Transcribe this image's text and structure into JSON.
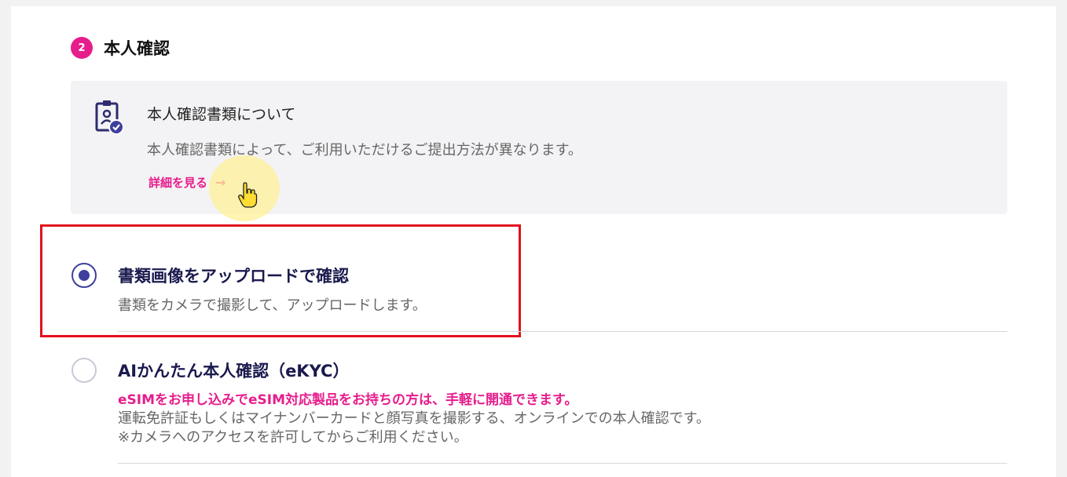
{
  "step": {
    "number": "2",
    "title": "本人確認"
  },
  "info_box": {
    "icon": "id-document-check-icon",
    "title": "本人確認書類について",
    "description": "本人確認書類によって、ご利用いただけるご提出方法が異なります。",
    "link_label": "詳細を見る",
    "link_arrow": "→"
  },
  "options": [
    {
      "title": "書類画像をアップロードで確認",
      "description": "書類をカメラで撮影して、アップロードします。",
      "selected": true
    },
    {
      "title": "AIかんたん本人確認（eKYC）",
      "highlight": "eSIMをお申し込みでeSIM対応製品をお持ちの方は、手軽に開通できます。",
      "description_line1": "運転免許証もしくはマイナンバーカードと顔写真を撮影する、オンラインでの本人確認です。",
      "description_line2": "※カメラへのアクセスを許可してからご利用ください。",
      "selected": false
    }
  ],
  "colors": {
    "accent_pink": "#e61e8c",
    "radio_navy": "#3f3f9f",
    "highlight_red": "#e3101c"
  }
}
